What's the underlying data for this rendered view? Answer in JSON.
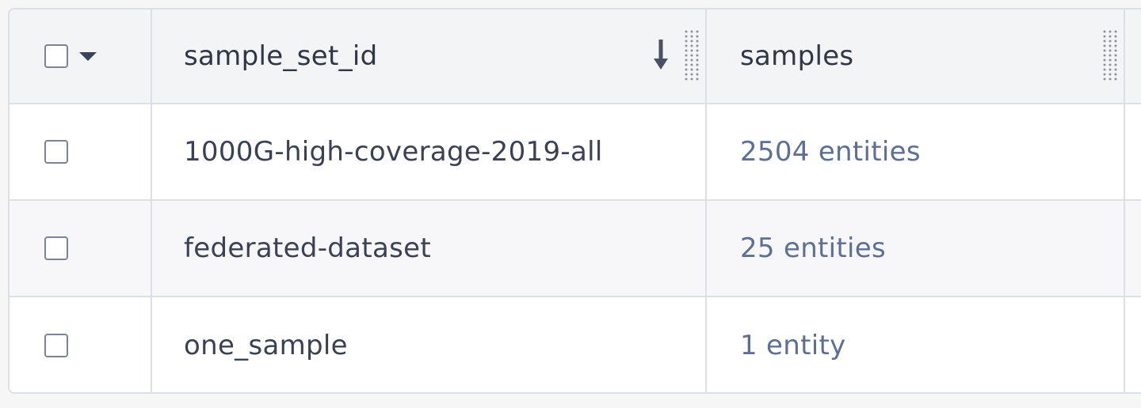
{
  "table": {
    "columns": [
      {
        "label": "sample_set_id",
        "sort": "descending"
      },
      {
        "label": "samples"
      }
    ],
    "rows": [
      {
        "sample_set_id": "1000G-high-coverage-2019-all",
        "samples": "2504 entities"
      },
      {
        "sample_set_id": "federated-dataset",
        "samples": "25 entities"
      },
      {
        "sample_set_id": "one_sample",
        "samples": "1 entity"
      }
    ]
  },
  "icons": {
    "select_all": "checkbox-icon",
    "select_menu": "caret-down-icon",
    "sort": "arrow-down-icon",
    "column_resize": "drag-handle-icon"
  },
  "colors": {
    "link": "#5d6f93",
    "header_bg": "#f3f4f6",
    "border": "#dcdfe5",
    "text": "#2f3646"
  }
}
